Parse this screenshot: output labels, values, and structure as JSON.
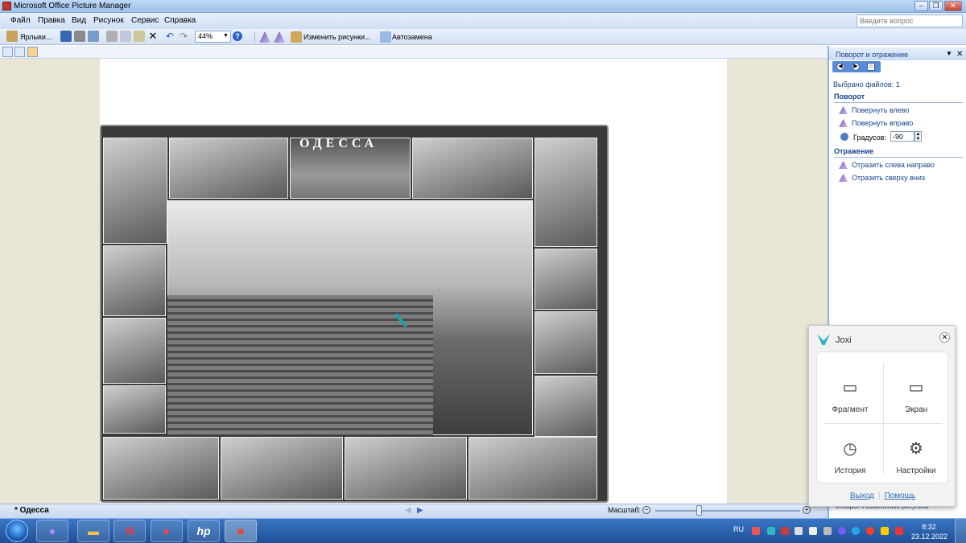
{
  "window": {
    "title": "Microsoft Office Picture Manager"
  },
  "menu": {
    "items": [
      "Файл",
      "Правка",
      "Вид",
      "Рисунок",
      "Сервис",
      "Справка"
    ],
    "help_placeholder": "Введите вопрос"
  },
  "toolbar": {
    "shortcuts_label": "Ярлыки...",
    "zoom_value": "44%",
    "edit_pictures_label": "Изменить рисунки...",
    "autocorrect_label": "Автозамена"
  },
  "photo": {
    "title": "ОДЕССА"
  },
  "status": {
    "file_name": "* Одесса",
    "scale_label": "Масштаб:",
    "zoom_level": 0.3
  },
  "task_pane": {
    "title": "Поворот и отражение",
    "files_selected": "Выбрано файлов: 1",
    "rotate_section": "Поворот",
    "rotate_left": "Повернуть влево",
    "rotate_right": "Повернуть вправо",
    "degrees_label": "Градусов:",
    "degrees_value": "-90",
    "flip_section": "Отражение",
    "flip_horizontal": "Отразить слева направо",
    "flip_vertical": "Отразить сверху вниз",
    "back_link": "Возврат к изменению рисунков"
  },
  "joxi": {
    "title": "Joxi",
    "fragment": "Фрагмент",
    "screen": "Экран",
    "history": "История",
    "settings": "Настройки",
    "exit": "Выход",
    "help": "Помощь"
  },
  "taskbar": {
    "language": "RU",
    "time": "8:32",
    "date": "23.12.2022",
    "yandex_browser_glyph": "Я",
    "hp_glyph": "hp"
  },
  "colors": {
    "accent": "#15428b",
    "joxi_brand": "#2fb5c5",
    "taskbar": "#1d4f98"
  }
}
